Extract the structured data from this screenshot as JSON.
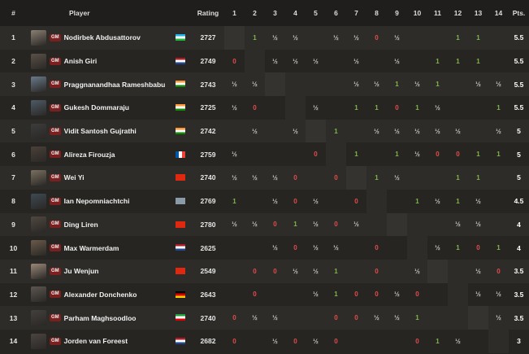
{
  "header": {
    "rank": "#",
    "player": "Player",
    "rating": "Rating",
    "rounds": [
      "1",
      "2",
      "3",
      "4",
      "5",
      "6",
      "7",
      "8",
      "9",
      "10",
      "11",
      "12",
      "13",
      "14"
    ],
    "points": "Pts."
  },
  "title_badge": "GM",
  "upcoming_icon": "pawn-icon",
  "rows": [
    {
      "rank": "1",
      "name": "Nodirbek Abdusattorov",
      "title": "GM",
      "country": "Uzbekistan",
      "rating": "2727",
      "points": "5.5",
      "avatar_color": "#8a7f72",
      "results": [
        "",
        "1",
        "½",
        "½",
        "",
        "½",
        "½",
        "0",
        "½",
        "",
        "",
        "1",
        "1",
        ""
      ]
    },
    {
      "rank": "2",
      "name": "Anish Giri",
      "title": "GM",
      "country": "Netherlands",
      "rating": "2749",
      "points": "5.5",
      "avatar_color": "#5a5048",
      "results": [
        "0",
        "",
        "½",
        "½",
        "½",
        "",
        "½",
        "",
        "½",
        "",
        "1",
        "1",
        "1",
        ""
      ]
    },
    {
      "rank": "3",
      "name": "Praggnanandhaa Rameshbabu",
      "title": "GM",
      "country": "India",
      "rating": "2743",
      "points": "5.5",
      "avatar_color": "#6a7a8a",
      "results": [
        "½",
        "½",
        "",
        "",
        "",
        "",
        "½",
        "½",
        "1",
        "½",
        "1",
        "",
        "½",
        "½"
      ]
    },
    {
      "rank": "4",
      "name": "Gukesh Dommaraju",
      "title": "GM",
      "country": "India",
      "rating": "2725",
      "points": "5.5",
      "avatar_color": "#4e5a66",
      "results": [
        "½",
        "0",
        "",
        "",
        "½",
        "",
        "1",
        "1",
        "0",
        "1",
        "½",
        "",
        "",
        "1"
      ]
    },
    {
      "rank": "5",
      "name": "Vidit Santosh Gujrathi",
      "title": "GM",
      "country": "India",
      "rating": "2742",
      "points": "5",
      "avatar_color": "#3c3c3c",
      "results": [
        "",
        "½",
        "",
        "½",
        "",
        "1",
        "",
        "½",
        "½",
        "½",
        "½",
        "½",
        "",
        "½"
      ]
    },
    {
      "rank": "6",
      "name": "Alireza Firouzja",
      "title": "GM",
      "country": "France",
      "rating": "2759",
      "points": "5",
      "avatar_color": "#4a4038",
      "results": [
        "½",
        "",
        "",
        "",
        "0",
        "",
        "1",
        "",
        "1",
        "½",
        "0",
        "0",
        "1",
        "1"
      ]
    },
    {
      "rank": "7",
      "name": "Wei Yi",
      "title": "GM",
      "country": "China",
      "rating": "2740",
      "points": "5",
      "avatar_color": "#7a7060",
      "results": [
        "½",
        "½",
        "½",
        "0",
        "",
        "0",
        "",
        "1",
        "½",
        "",
        "",
        "1",
        "1",
        ""
      ]
    },
    {
      "rank": "8",
      "name": "Ian Nepomniachtchi",
      "title": "GM",
      "country": "FIDE",
      "rating": "2769",
      "points": "4.5",
      "avatar_color": "#3e4a52",
      "results": [
        "1",
        "",
        "½",
        "0",
        "½",
        "",
        "0",
        "",
        "",
        "1",
        "½",
        "1",
        "½",
        ""
      ]
    },
    {
      "rank": "9",
      "name": "Ding Liren",
      "title": "GM",
      "country": "China",
      "rating": "2780",
      "points": "4",
      "avatar_color": "#504840",
      "results": [
        "½",
        "½",
        "0",
        "1",
        "½",
        "0",
        "½",
        "",
        "",
        "",
        "",
        "½",
        "½",
        ""
      ]
    },
    {
      "rank": "10",
      "name": "Max Warmerdam",
      "title": "GM",
      "country": "Netherlands",
      "rating": "2625",
      "points": "4",
      "avatar_color": "#6a5a4a",
      "results": [
        "",
        "",
        "½",
        "0",
        "½",
        "½",
        "",
        "0",
        "",
        "",
        "½",
        "1",
        "0",
        "1"
      ]
    },
    {
      "rank": "11",
      "name": "Ju Wenjun",
      "title": "GM",
      "country": "China",
      "rating": "2549",
      "points": "3.5",
      "avatar_color": "#9a8878",
      "results": [
        "",
        "0",
        "0",
        "½",
        "½",
        "1",
        "",
        "0",
        "",
        "½",
        "",
        "",
        "½",
        "0"
      ]
    },
    {
      "rank": "12",
      "name": "Alexander Donchenko",
      "title": "GM",
      "country": "Germany",
      "rating": "2643",
      "points": "3.5",
      "avatar_color": "#5c5650",
      "results": [
        "",
        "0",
        "",
        "",
        "½",
        "1",
        "0",
        "0",
        "½",
        "0",
        "",
        "",
        "½",
        "½"
      ]
    },
    {
      "rank": "13",
      "name": "Parham Maghsoodloo",
      "title": "GM",
      "country": "Iran",
      "rating": "2740",
      "points": "3.5",
      "avatar_color": "#44403c",
      "results": [
        "0",
        "½",
        "½",
        "",
        "",
        "0",
        "0",
        "½",
        "½",
        "1",
        "",
        "",
        "",
        "½"
      ]
    },
    {
      "rank": "14",
      "name": "Jorden van Foreest",
      "title": "GM",
      "country": "Netherlands",
      "rating": "2682",
      "points": "3",
      "avatar_color": "#4a4440",
      "results": [
        "0",
        "",
        "½",
        "0",
        "½",
        "0",
        "",
        "",
        "",
        "0",
        "1",
        "½",
        "",
        "½"
      ]
    }
  ],
  "colors": {
    "win": "#81b64c",
    "loss": "#e24c4c",
    "draw": "#c5c5c5",
    "badge": "#7b1f1f",
    "background": "#262522"
  }
}
